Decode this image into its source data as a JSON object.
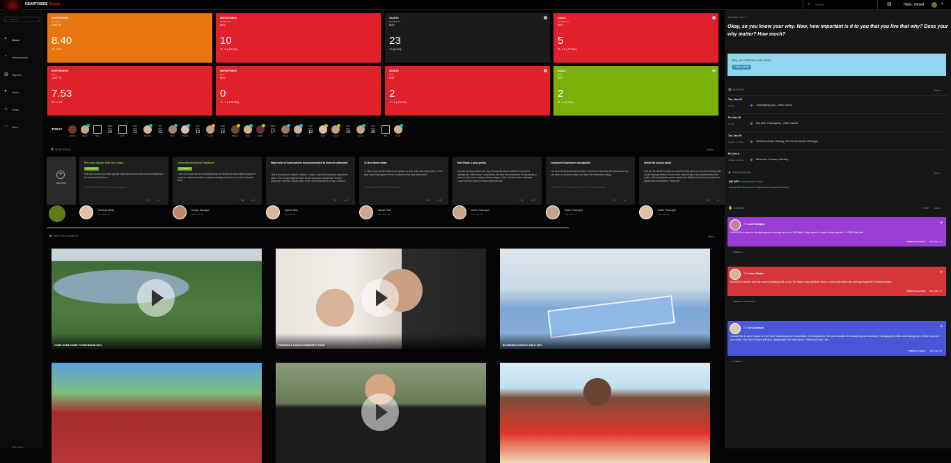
{
  "topbar": {
    "brand_main": "HEARTHSIDE",
    "brand_accent": "Homes",
    "search_placeholder": "Search...",
    "greeting": "Hello, Yahyel"
  },
  "sidebar": {
    "search_placeholder": "Search...",
    "items": [
      {
        "label": "Home",
        "icon": "heart-icon"
      },
      {
        "label": "Performance",
        "icon": "gauge-icon"
      },
      {
        "label": "Reports",
        "icon": "chart-icon"
      },
      {
        "label": "Users",
        "icon": "users-icon"
      },
      {
        "label": "Pulse",
        "icon": "pulse-icon"
      },
      {
        "label": "More",
        "icon": "more-icon"
      }
    ],
    "help": "Help Center"
  },
  "summary": [
    {
      "title": "SUPPORTERS",
      "sub": "ON REACH",
      "period": "LAST 30",
      "value": "8.40",
      "change": "▼ -0.20",
      "color": "orange",
      "info": false
    },
    {
      "title": "DEPARTURES",
      "sub": "ON REACH",
      "period": "NOV",
      "value": "10",
      "change": "▼ -3 (-23.1%)",
      "color": "red",
      "info": false
    },
    {
      "title": "STARTS",
      "sub": "ON REACH",
      "period": "NOV",
      "value": "23",
      "change": "+0 (0.0%)",
      "color": "dark",
      "info": true
    },
    {
      "title": "SALES",
      "sub": "ON REACH",
      "period": "NOV",
      "value": "5",
      "change": "▼ -17 (-77.3%)",
      "color": "red",
      "info": true
    },
    {
      "title": "SUPPORTERS",
      "sub": "RVA",
      "period": "LAST 76",
      "value": "7.53",
      "change": "▼ +0.13",
      "color": "red",
      "info": false
    },
    {
      "title": "DEPARTURES",
      "sub": "RVA",
      "period": "NOV",
      "value": "0",
      "change": "▼ -1 (-100.0%)",
      "color": "red",
      "info": false
    },
    {
      "title": "STARTS",
      "sub": "RVA",
      "period": "NOV",
      "value": "2",
      "change": "▼ -3 (-23.3%)",
      "color": "red",
      "info": true
    },
    {
      "title": "SALES",
      "sub": "RVA",
      "period": "NOV",
      "value": "2",
      "change": "▼ +0 (0.0%)",
      "color": "green",
      "info": true
    }
  ],
  "today": {
    "label": "TODAY",
    "entries": [
      {
        "kind": "person",
        "name": "Anthony",
        "color": "#6a3b2a",
        "badge": ""
      },
      {
        "kind": "person",
        "name": "Roger",
        "color": "#c9a58a",
        "badge": "b"
      },
      {
        "kind": "box",
        "name": "Doug"
      },
      {
        "kind": "date",
        "dow": "WED",
        "mon": "NOV",
        "day": "10"
      },
      {
        "kind": "box",
        "name": "Josh"
      },
      {
        "kind": "date",
        "dow": "THU",
        "mon": "NOV",
        "day": "11"
      },
      {
        "kind": "person",
        "name": "Shannon",
        "color": "#d7b79e",
        "badge": "b"
      },
      {
        "kind": "date",
        "dow": "FRI",
        "mon": "NOV",
        "day": "12"
      },
      {
        "kind": "person",
        "name": "Tyler",
        "color": "#9a8a7a",
        "badge": "b"
      },
      {
        "kind": "person",
        "name": "Thomas",
        "color": "#d6c1ae",
        "badge": "b"
      },
      {
        "kind": "date",
        "dow": "SAT",
        "mon": "NOV",
        "day": "13"
      },
      {
        "kind": "person",
        "name": "Lucas",
        "color": "#c4a07e",
        "badge": "y"
      },
      {
        "kind": "date",
        "dow": "TUE",
        "mon": "NOV",
        "day": "16"
      },
      {
        "kind": "person",
        "name": "Warren",
        "color": "#6a4a3a",
        "badge": "y"
      },
      {
        "kind": "person",
        "name": "Mark",
        "color": "#d2b394",
        "badge": "b"
      },
      {
        "kind": "person",
        "name": "Shelby",
        "color": "#6a2a3a",
        "badge": "y"
      },
      {
        "kind": "date",
        "dow": "WED",
        "mon": "NOV",
        "day": "17"
      },
      {
        "kind": "person",
        "name": "Brittnie",
        "color": "#a07a5a",
        "badge": "b"
      },
      {
        "kind": "person",
        "name": "Dan",
        "color": "#cfb39a",
        "badge": "b"
      },
      {
        "kind": "date",
        "dow": "THU",
        "mon": "NOV",
        "day": "18"
      },
      {
        "kind": "person",
        "name": "Zach",
        "color": "#d9c2a8",
        "badge": "y"
      },
      {
        "kind": "person",
        "name": "Frank",
        "color": "#bba28a",
        "badge": "y"
      },
      {
        "kind": "date",
        "dow": "FRI",
        "mon": "NOV",
        "day": "19"
      },
      {
        "kind": "person",
        "name": "James",
        "color": "#c8a58a",
        "badge": "b"
      },
      {
        "kind": "date",
        "dow": "SAT",
        "mon": "NOV",
        "day": "20"
      },
      {
        "kind": "box",
        "name": "Bob"
      },
      {
        "kind": "person",
        "name": "Derek",
        "color": "#d3b496",
        "badge": "b"
      }
    ]
  },
  "ideas": {
    "heading": "New Ideas",
    "more": "More",
    "add_label": "Add Idea",
    "cards": [
      {
        "title": "Pete barn houses with barn doors",
        "tag": "Completed",
        "body": "Pete barn houses are really popular right now and there are not many builders in the area that build them.",
        "faded": "We should offer barn doors to our upgraded",
        "likes": "2",
        "comments": "",
        "author": "Amanda Bartly",
        "date": "Thu, Mar '21",
        "avatar": "#e0c4aa"
      },
      {
        "title": "Library/Bookshop on Hearthnet",
        "tag": "Completed",
        "body": "I think we should add a Library/Bookshop on Hearthnet. Many different types of books are discussed at the company meetings, but there is no place to locate them.",
        "faded": "",
        "likes": "11",
        "comments": "1",
        "author": "Megan Spangler",
        "date": "Wed, Mar '21",
        "avatar": "#c08a68"
      },
      {
        "title": "Watercolor of homeowners house presented to them at settlement",
        "tag": "",
        "body": "This is an add on to Adam's, Jamie's, Lamar's, and other customer experience ideas. This is what happens when we are driving to softball and I am the passenger. We take a quick photo of the new homeowners' house, it doesn't",
        "faded": "",
        "likes": "8",
        "comments": "2",
        "author": "Alyssa Titus",
        "date": "Fri, Mar '21",
        "avatar": "#d9b89c"
      },
      {
        "title": "11 New Home Ideas",
        "tag": "",
        "body": "1 - Add a prop kitchen hidden from guests so your main area stays clean. 2 One step I (web link) please see the contents of this idea here points!",
        "faded": "If Anywhere Potential Work Assembly",
        "likes": "0",
        "comments": "2",
        "author": "Alyssa Titus",
        "date": "Sun, Mar '21",
        "avatar": "#d0a58a"
      },
      {
        "title": "New Home, Lucky penny",
        "tag": "",
        "body": "It would be incorporated into my previous idea about customer experience checkpoints. New Home, Lucky penny. We give the homeowner a lucky penny to place in their home, maybe at frame stage or later. It comes with a message. Lucky from the penny is infused with love and",
        "faded": "",
        "likes": "1",
        "comments": "3",
        "author": "Adam Pettengell",
        "date": "Thu, Mar '21",
        "avatar": "#c8a58a"
      },
      {
        "title": "Customer Experience checkpoints",
        "tag": "",
        "body": "I've been thinking about the customer experience and how with checkpoints we can keep our process unique and keep the homeowner happy.",
        "faded": "Would there be a touch point on a sort of building stage",
        "likes": "1",
        "comments": "",
        "author": "Adam Pettengell",
        "date": "Thu, Mar '21",
        "avatar": "#c8a58a"
      },
      {
        "title": "Schell file (house-hack)",
        "tag": "",
        "body": "A lot like file talk file houses we would like little gems on our homes that people would really get behind. At my recent walk-through I was informed about the profile: kitchen/bathroom accent drawer and ability to lower the top drawer for quick family accessories. Things like",
        "faded": "",
        "likes": "5",
        "comments": "",
        "author": "Adam Pettengell",
        "date": "Thu, Mar '21",
        "avatar": "#dcc0a8"
      }
    ]
  },
  "photos": {
    "heading": "Photos & Videos",
    "more": "More",
    "items": [
      {
        "title": "COME HOME HOME TO RICHMOND 2021",
        "video": true,
        "scene": "lake"
      },
      {
        "title": "PENINSULA LAKES COMMUNITY TOUR",
        "video": true,
        "scene": "couple"
      },
      {
        "title": "BOARDWALK BUDDY WALK 2021",
        "video": false,
        "scene": "kids"
      },
      {
        "title": "",
        "video": false,
        "scene": "team"
      },
      {
        "title": "",
        "video": true,
        "scene": "man"
      },
      {
        "title": "",
        "video": false,
        "scene": "beach"
      }
    ]
  },
  "right": {
    "date": "Tuesday, Nov 9",
    "question": "Okay, so you know your why. Now, how important is it to you that you live that why? Does your why matter? How much?",
    "photo_prompt": "Hey, we can't see your face!",
    "photo_btn": "+ Add a photo",
    "events_heading": "Events",
    "events_more": "More",
    "events": [
      {
        "day": "Thu, Nov 25",
        "time": "all day",
        "name": "Thanksgiving Day - Office Closed"
      },
      {
        "day": "Fri, Nov 26",
        "time": "all day",
        "name": "Day After Thanksgiving - Office Closed"
      },
      {
        "day": "Tue, Nov 30",
        "time": "9:00am - 9:00am",
        "name": "Q4/All November Meeting (The 2nd November Meetings)"
      },
      {
        "day": "Fri, Dec 3",
        "time": "9:00am - 9:00am",
        "name": "December Company Meeting"
      }
    ],
    "promo_heading": "Promotions",
    "promo_more": "More",
    "promo_title": "$50 OFF",
    "promo_link": "all Accessories Travel",
    "promo_text": "Receive $50 off per person on WE'll Day or Longer River Cruises",
    "kudos_heading": "Kudos",
    "kudos_help": "Help?",
    "kudos_more": "More",
    "kudos": [
      {
        "to": "Lanie Bologna",
        "msg": "KUDOS to Lanie for designing and ordering all of our St Patty's Day treats! It made today special. I LOVE that hat!",
        "from": "FROM Alyssa Titus",
        "date": "Wed, Mar '17",
        "likes": "19 likes",
        "comments": "",
        "color": "#9a3ed6",
        "avatar": "#c3849a"
      },
      {
        "to": "Amber Parker",
        "msg": "KUDOS to Amber and her son for packing 261 of our St Patty's Day goodies! Such a nice treat when we can't get together! Thanks Amber.",
        "from": "FROM Alyssa Titus",
        "date": "Wed, Mar '17",
        "likes": "18 likes",
        "comments": "2 comments",
        "color": "#d6373a",
        "avatar": "#cdb59e"
      },
      {
        "to": "Keri Davidson",
        "msg": "I would like to give Kudos to Keri. Keri holds down our shop/office in Georgetown. Her job consists of overseeing our inventory, managing the office and taking care of the hours for our crews. Her job is never dull and I appreciate her very much. Thank you Keri. Jen",
        "from": "FROM Jen Skiver",
        "date": "Mon, Mar '15",
        "likes": "11 likes",
        "comments": "",
        "color": "#4a57d8",
        "avatar": "#e0c6aa"
      }
    ]
  }
}
